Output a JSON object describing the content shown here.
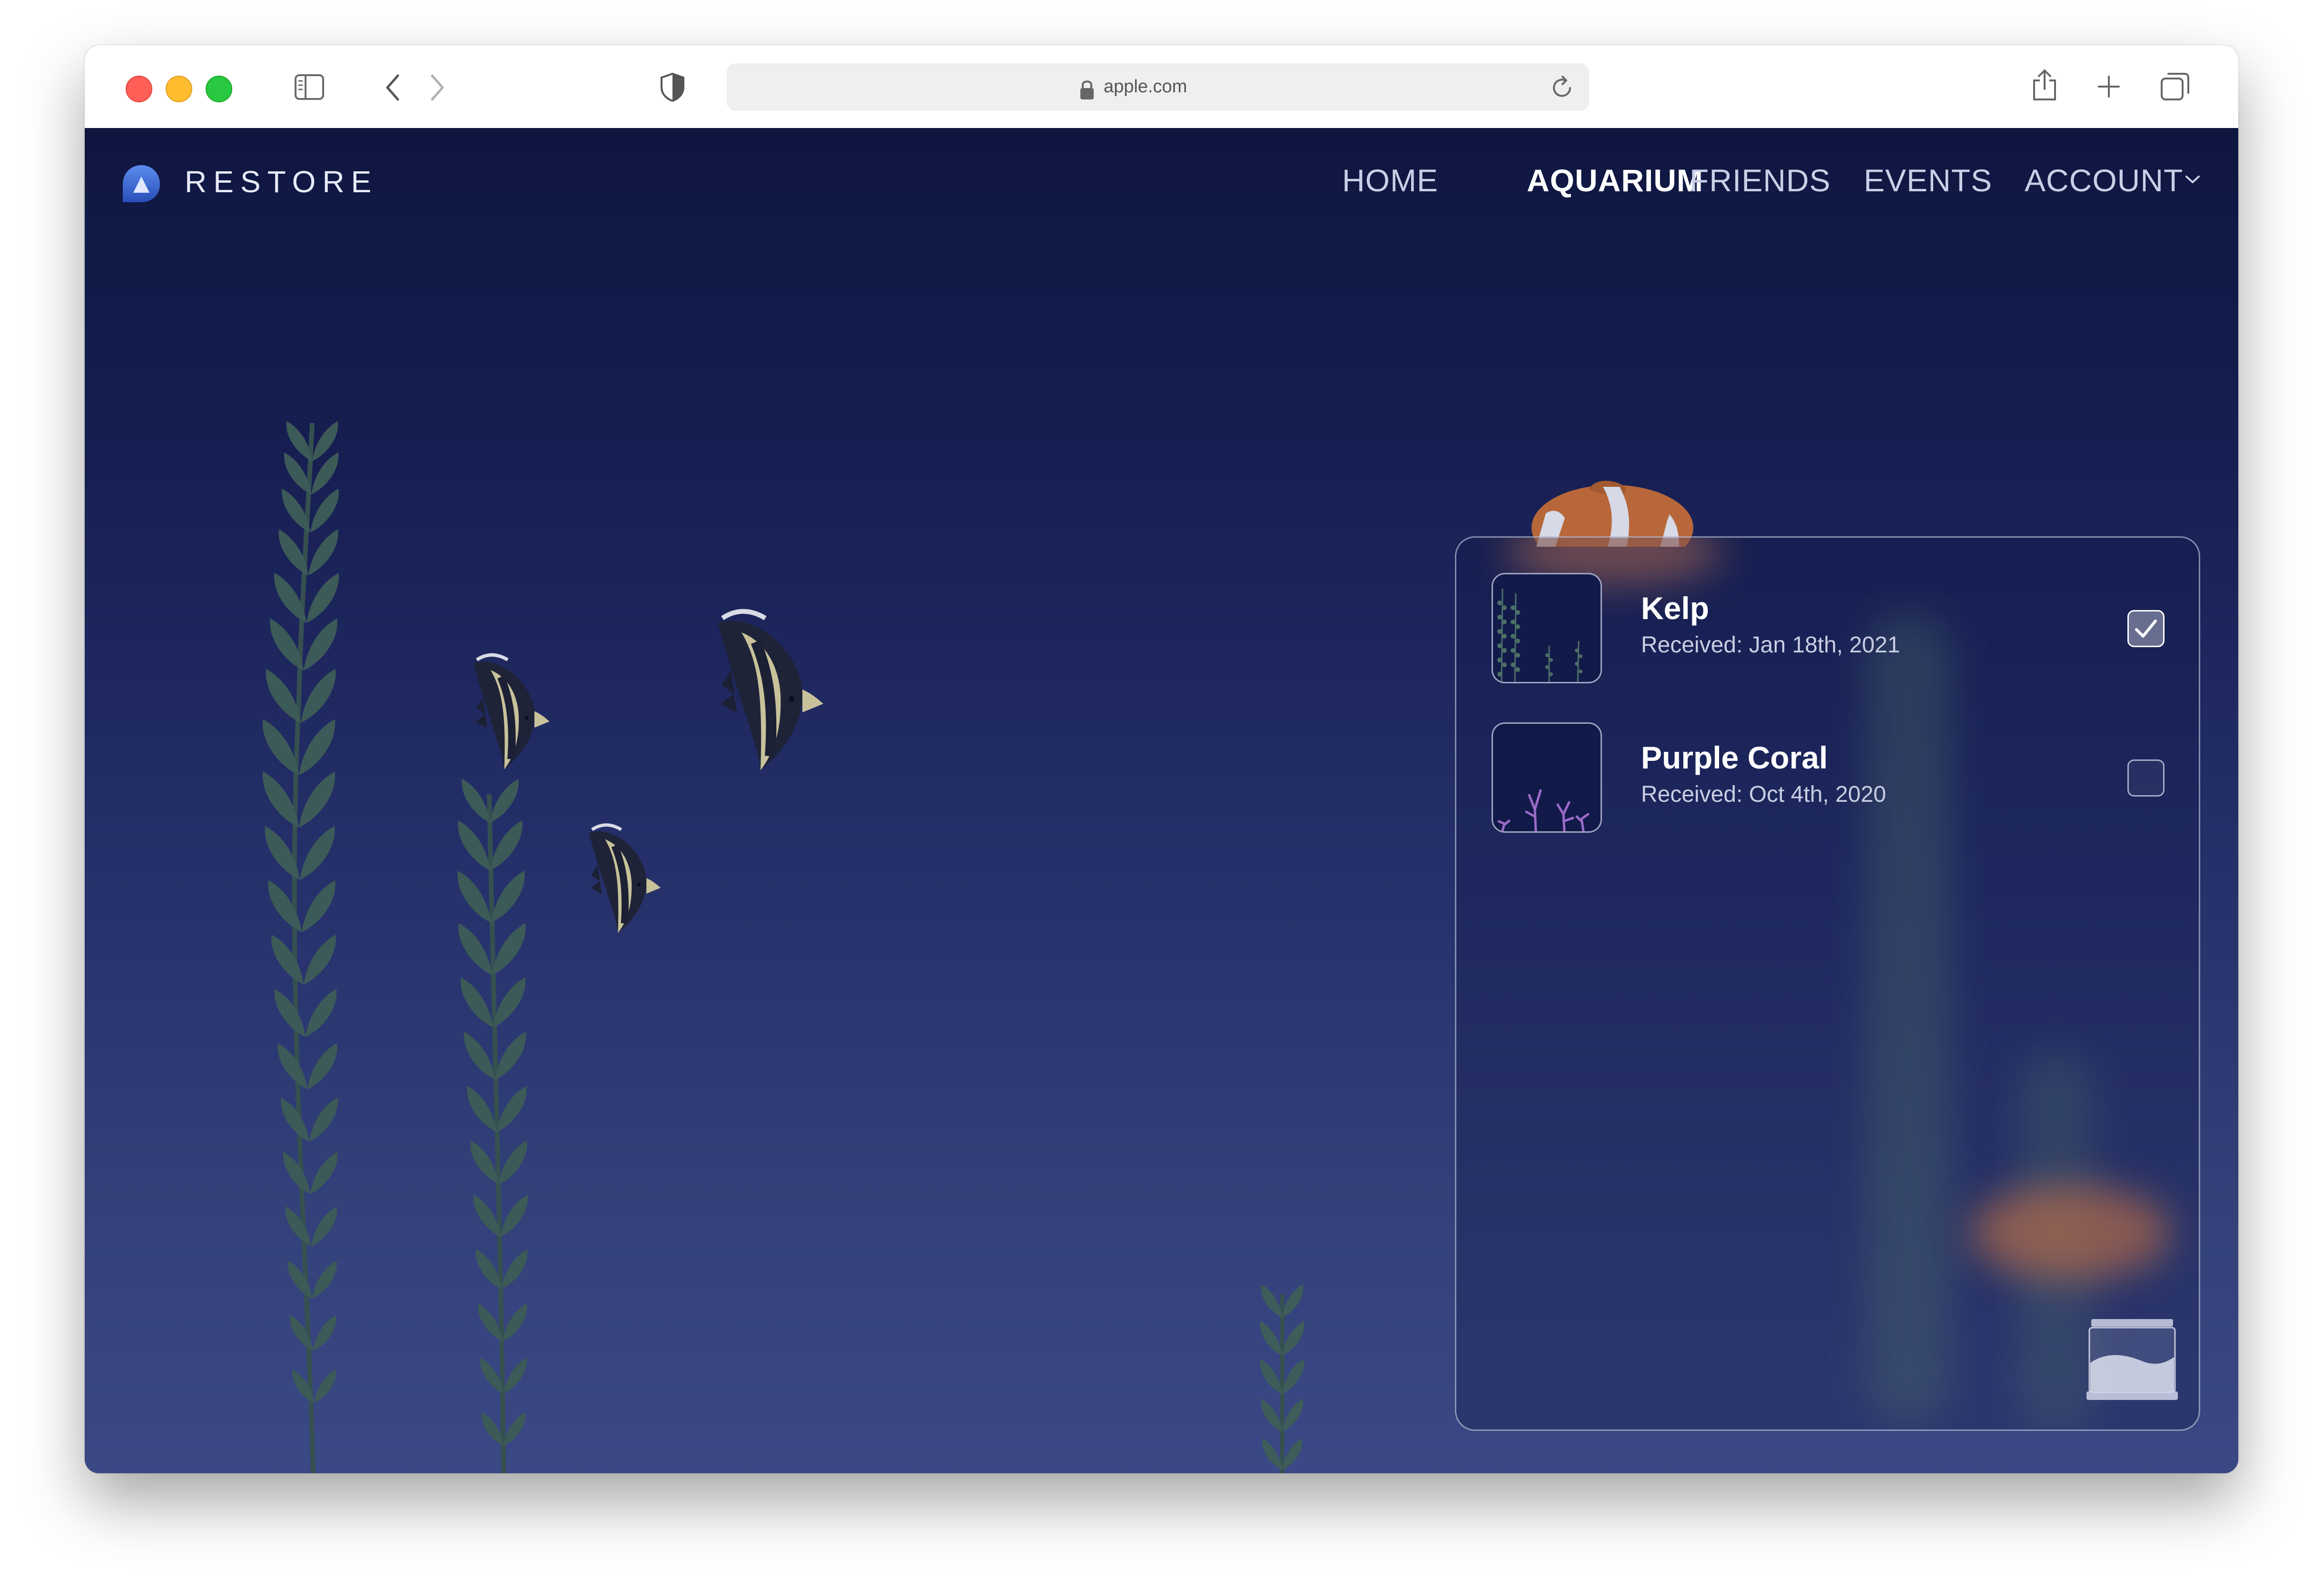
{
  "browser": {
    "url": "apple.com",
    "icons": [
      "sidebar-icon",
      "back-icon",
      "forward-icon",
      "shield-icon",
      "lock-icon",
      "reload-icon",
      "share-icon",
      "new-tab-icon",
      "tabs-overview-icon"
    ]
  },
  "site": {
    "brand": "RESTORE",
    "nav": {
      "home": "HOME",
      "aquarium": "AQUARIUM",
      "friends": "FRIENDS",
      "events": "EVENTS",
      "account": "ACCOUNT"
    },
    "active_nav": "AQUARIUM"
  },
  "inventory": {
    "items": [
      {
        "name": "Kelp",
        "received": "Received: Jan 18th, 2021",
        "checked": true
      },
      {
        "name": "Purple Coral",
        "received": "Received: Oct 4th, 2020",
        "checked": false
      }
    ]
  },
  "colors": {
    "background_top": "#0e1640",
    "background_bottom": "#3b4885",
    "kelp": "#3c5a58",
    "coral": "#9b6bc8"
  }
}
